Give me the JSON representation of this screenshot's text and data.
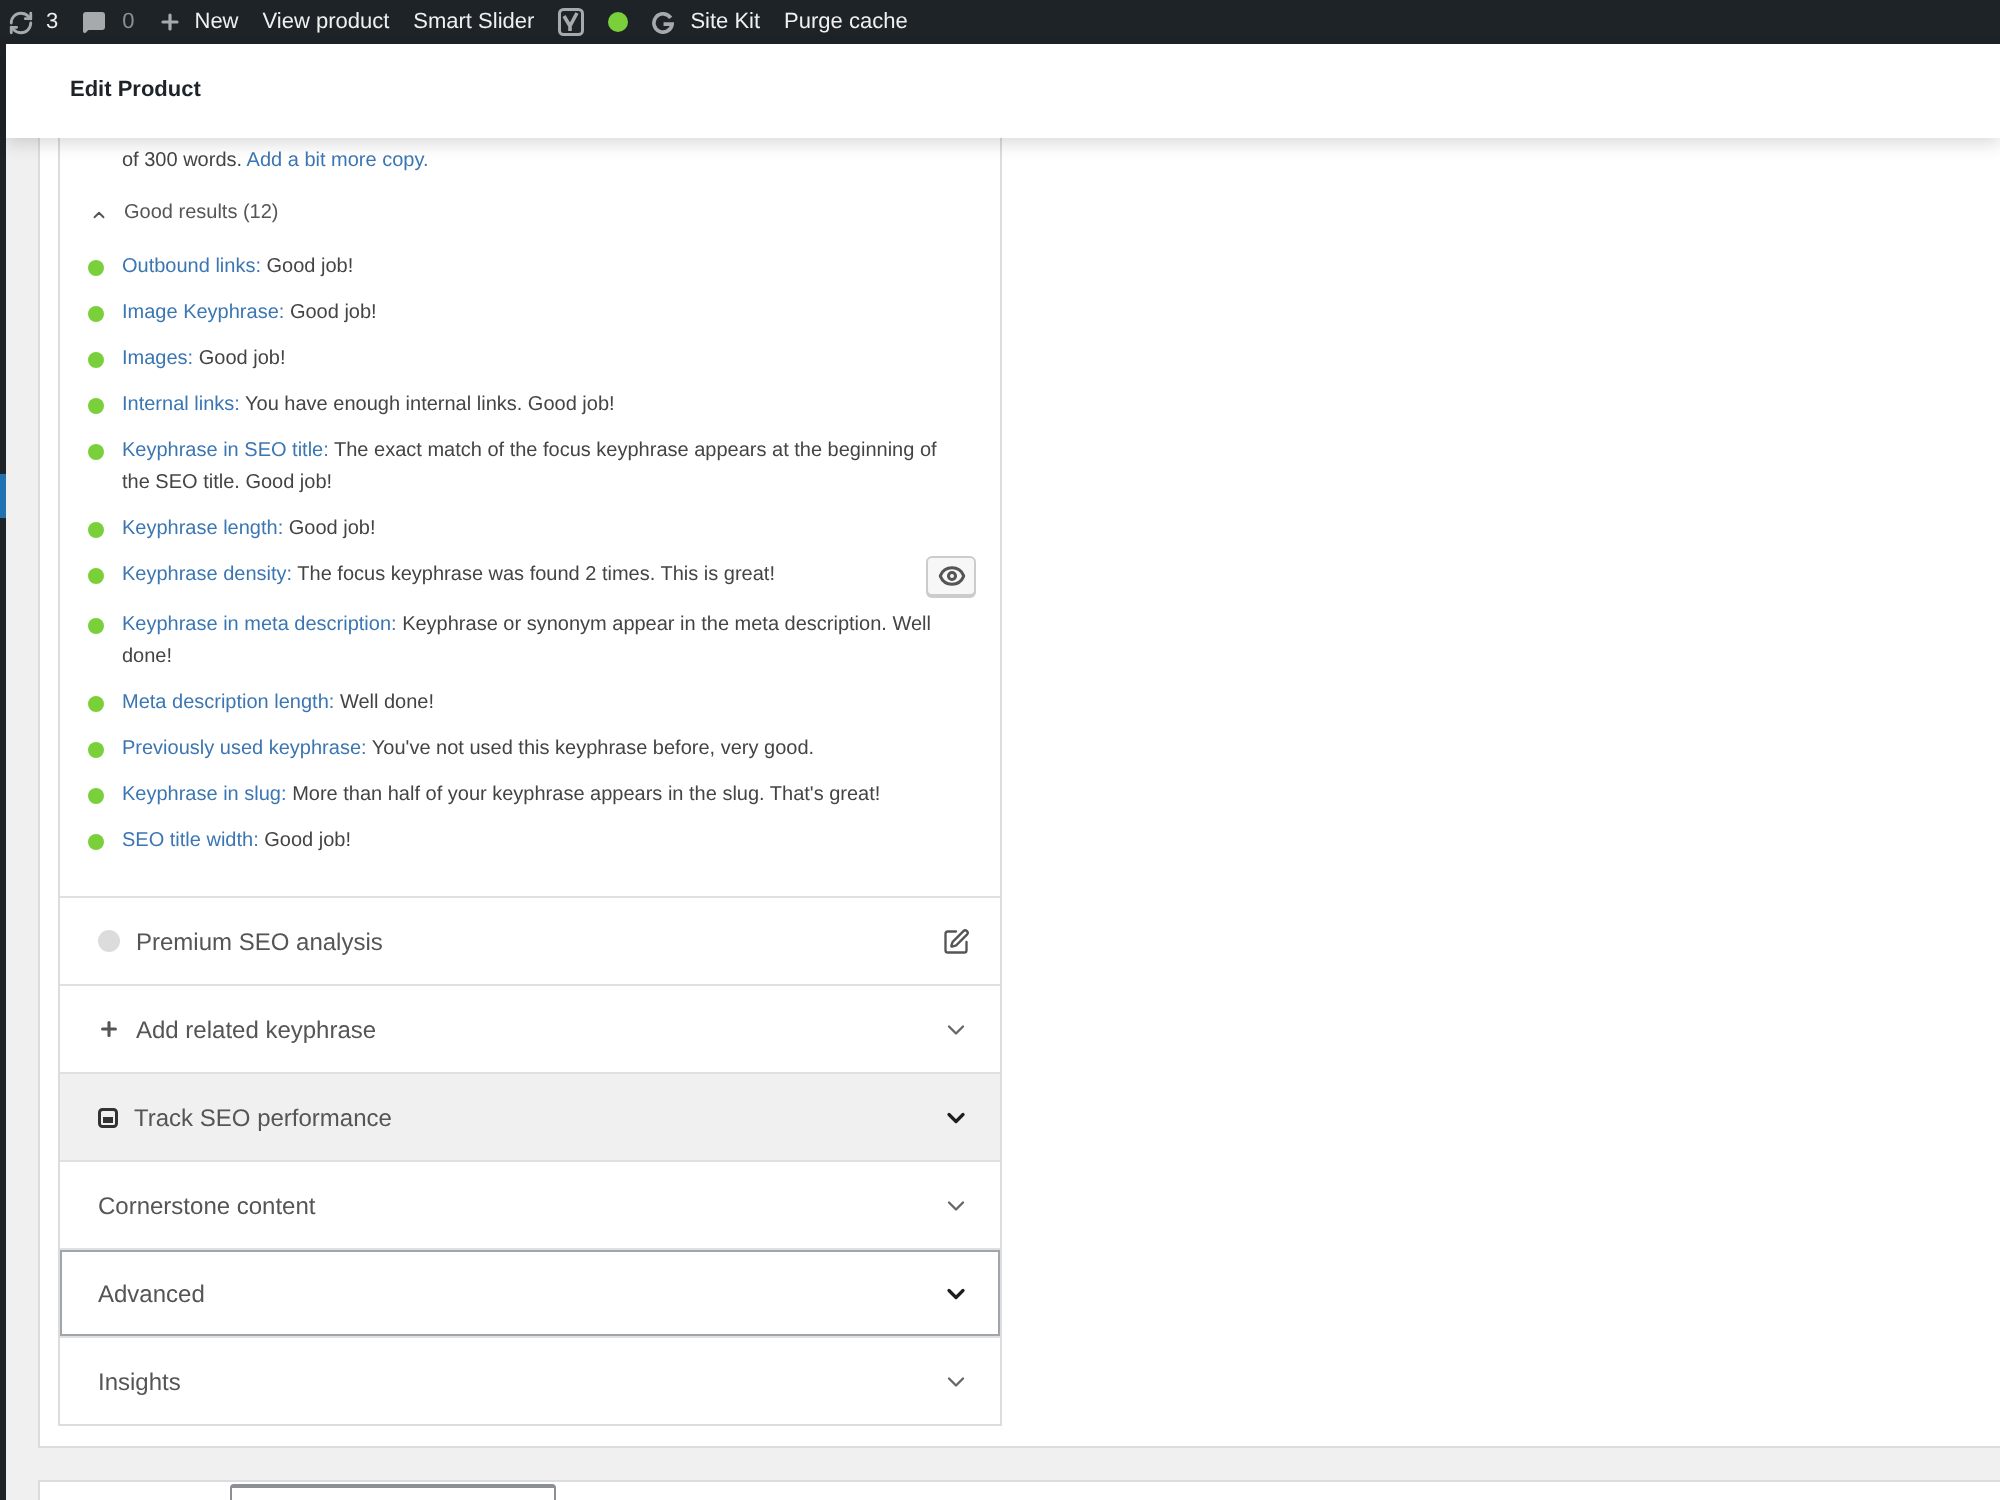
{
  "admin_bar": {
    "items": [
      {
        "kind": "updates",
        "label": "3"
      },
      {
        "kind": "comments",
        "label": "0"
      },
      {
        "kind": "new",
        "label": "New"
      },
      {
        "kind": "link",
        "label": "View product"
      },
      {
        "kind": "link",
        "label": "Smart Slider"
      },
      {
        "kind": "seo_logo"
      },
      {
        "kind": "status_dot"
      },
      {
        "kind": "site_kit",
        "label": "Site Kit"
      },
      {
        "kind": "link",
        "label": "Purge cache"
      }
    ]
  },
  "header": {
    "title": "Edit Product"
  },
  "readability_tail": {
    "text": "of 300 words.",
    "link": "Add a bit more copy."
  },
  "good_results": {
    "label": "Good results (12)",
    "expanded": true,
    "items": [
      {
        "link": "Outbound links:",
        "text": "Good job!",
        "marker_button": false
      },
      {
        "link": "Image Keyphrase:",
        "text": "Good job!",
        "marker_button": false
      },
      {
        "link": "Images:",
        "text": "Good job!",
        "marker_button": false
      },
      {
        "link": "Internal links:",
        "text": "You have enough internal links. Good job!",
        "marker_button": false
      },
      {
        "link": "Keyphrase in SEO title:",
        "text": "The exact match of the focus keyphrase appears at the beginning of the SEO title. Good job!",
        "marker_button": false
      },
      {
        "link": "Keyphrase length:",
        "text": "Good job!",
        "marker_button": false
      },
      {
        "link": "Keyphrase density:",
        "text": "The focus keyphrase was found 2 times. This is great!",
        "marker_button": true
      },
      {
        "link": "Keyphrase in meta description:",
        "text": "Keyphrase or synonym appear in the meta description. Well done!",
        "marker_button": false
      },
      {
        "link": "Meta description length:",
        "text": "Well done!",
        "marker_button": false
      },
      {
        "link": "Previously used keyphrase:",
        "text": "You've not used this keyphrase before, very good.",
        "marker_button": false
      },
      {
        "link": "Keyphrase in slug:",
        "text": "More than half of your keyphrase appears in the slug. That's great!",
        "marker_button": false
      },
      {
        "link": "SEO title width:",
        "text": "Good job!",
        "marker_button": false
      }
    ]
  },
  "sections": [
    {
      "kind": "premium",
      "label": "Premium SEO analysis",
      "hovered": false,
      "focused": false
    },
    {
      "kind": "add",
      "label": "Add related keyphrase",
      "hovered": false,
      "focused": false
    },
    {
      "kind": "track",
      "label": "Track SEO performance",
      "hovered": true,
      "focused": false
    },
    {
      "kind": "plain",
      "label": "Cornerstone content",
      "hovered": false,
      "focused": false
    },
    {
      "kind": "plain",
      "label": "Advanced",
      "hovered": false,
      "focused": true
    },
    {
      "kind": "plain",
      "label": "Insights",
      "hovered": false,
      "focused": false
    }
  ]
}
